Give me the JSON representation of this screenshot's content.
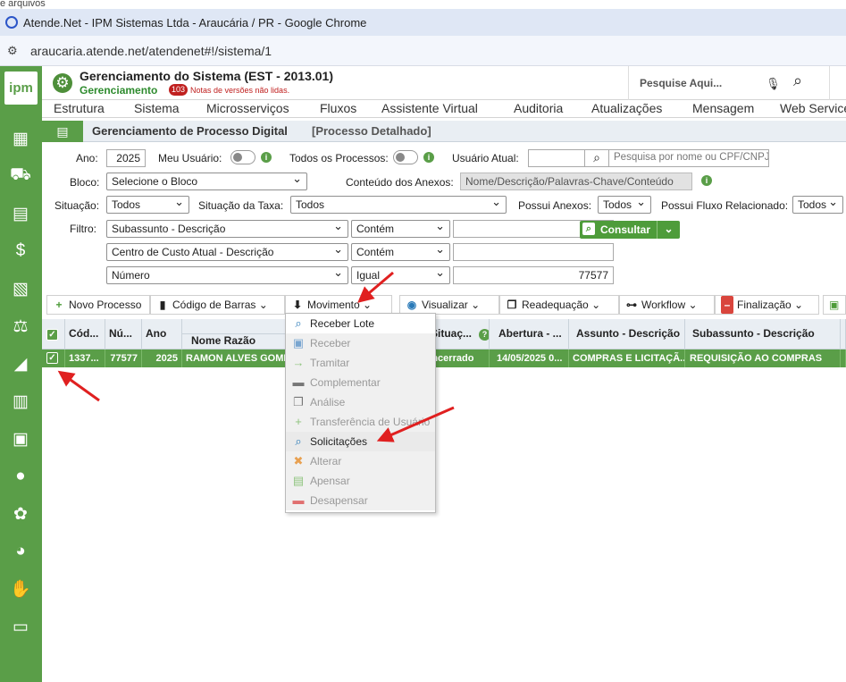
{
  "browser": {
    "partial_text": "e arquivos",
    "window_title": "Atende.Net - IPM Sistemas Ltda - Araucária / PR - Google Chrome",
    "url": "araucaria.atende.net/atendenet#!/sistema/1"
  },
  "sidebar": {
    "logo": "ipm",
    "icons": [
      "calculator-icon",
      "truck-icon",
      "clipboard-user-icon",
      "hand-money-icon",
      "document-tools-icon",
      "scale-icon",
      "chart-icon",
      "building-icon",
      "calculator-grid-icon",
      "user-gear-icon",
      "gear-icon",
      "pie-chart-icon",
      "hand-stop-icon",
      "user-screen-icon"
    ]
  },
  "header": {
    "title": "Gerenciamento do Sistema (EST - 2013.01)",
    "subtitle": "Gerenciamento",
    "badge": "103",
    "notes": "Notas de versões não lidas.",
    "search_placeholder": "Pesquise Aqui..."
  },
  "menu": [
    "Estrutura",
    "Sistema",
    "Microsserviços",
    "Fluxos",
    "Assistente Virtual",
    "Auditoria",
    "Atualizações",
    "Mensagem",
    "Web Services"
  ],
  "page": {
    "title": "Gerenciamento de Processo Digital",
    "subtitle": "[Processo Detalhado]"
  },
  "form": {
    "ano_label": "Ano:",
    "ano_value": "2025",
    "meu_usuario_label": "Meu Usuário:",
    "todos_processos_label": "Todos os Processos:",
    "usuario_atual_label": "Usuário Atual:",
    "usuario_atual_value": "",
    "pesquisa_placeholder": "Pesquisa por nome ou CPF/CNPJ",
    "bloco_label": "Bloco:",
    "bloco_value": "Selecione o Bloco",
    "conteudo_label": "Conteúdo dos Anexos:",
    "conteudo_placeholder": "Nome/Descrição/Palavras-Chave/Conteúdo",
    "situacao_label": "Situação:",
    "situacao_value": "Todos",
    "situacao_taxa_label": "Situação da Taxa:",
    "situacao_taxa_value": "Todos",
    "possui_anexos_label": "Possui Anexos:",
    "possui_anexos_value": "Todos",
    "possui_fluxo_label": "Possui Fluxo Relacionado:",
    "possui_fluxo_value": "Todos",
    "filtro_label": "Filtro:",
    "filters": [
      {
        "field": "Subassunto - Descrição",
        "op": "Contém",
        "value": ""
      },
      {
        "field": "Centro de Custo Atual - Descrição",
        "op": "Contém",
        "value": ""
      },
      {
        "field": "Número",
        "op": "Igual",
        "value": "77577"
      }
    ],
    "consultar_label": "Consultar"
  },
  "toolbar": {
    "novo": "Novo Processo",
    "codigo": "Código de Barras",
    "movimento": "Movimento",
    "visualizar": "Visualizar",
    "readequacao": "Readequação",
    "workflow": "Workflow",
    "finalizacao": "Finalização"
  },
  "grid": {
    "headers": {
      "cod": "Cód...",
      "num": "Nú...",
      "ano": "Ano",
      "requerente": "Requerent",
      "nome_razao": "Nome Razão",
      "situacao": "Situaç...",
      "abertura": "Abertura - ...",
      "assunto": "Assunto - Descrição",
      "subassunto": "Subassunto - Descrição"
    },
    "row": {
      "cod": "1337...",
      "num": "77577",
      "ano": "2025",
      "nome": "RAMON ALVES GOME",
      "situacao": "Encerrado",
      "abertura": "14/05/2025 0...",
      "assunto": "COMPRAS E LICITAÇÃ...",
      "subassunto": "REQUISIÇÃO AO COMPRAS"
    }
  },
  "movimento_menu": [
    {
      "label": "Receber Lote",
      "icon": "search-icon",
      "enabled": true
    },
    {
      "label": "Receber",
      "icon": "receive-icon",
      "enabled": false
    },
    {
      "label": "Tramitar",
      "icon": "arrow-right-icon",
      "enabled": false
    },
    {
      "label": "Complementar",
      "icon": "archive-icon",
      "enabled": false
    },
    {
      "label": "Análise",
      "icon": "copy-icon",
      "enabled": false
    },
    {
      "label": "Transferência de Usuário",
      "icon": "plus-icon",
      "enabled": false
    },
    {
      "label": "Solicitações",
      "icon": "search-icon",
      "enabled": true
    },
    {
      "label": "Alterar",
      "icon": "tools-icon",
      "enabled": false
    },
    {
      "label": "Apensar",
      "icon": "attach-icon",
      "enabled": false
    },
    {
      "label": "Desapensar",
      "icon": "detach-icon",
      "enabled": false
    }
  ],
  "colors": {
    "accent": "#5a9e48",
    "arrow": "#e02020"
  }
}
